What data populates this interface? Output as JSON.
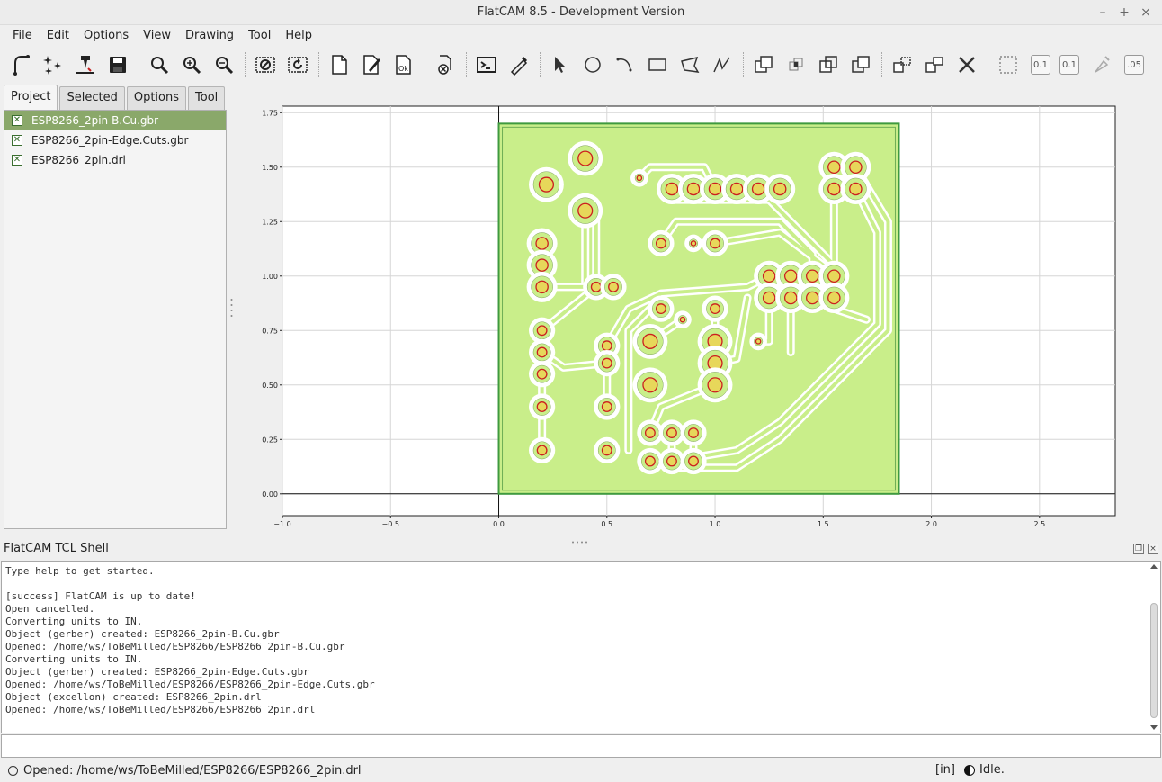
{
  "window": {
    "title": "FlatCAM 8.5 - Development Version",
    "controls": [
      "–",
      "+",
      "×"
    ]
  },
  "menu": [
    "File",
    "Edit",
    "Options",
    "View",
    "Drawing",
    "Tool",
    "Help"
  ],
  "toolbar": {
    "icons": [
      "open-gerber-icon",
      "open-excellon-icon",
      "open-gcode-icon",
      "save-icon",
      "zoom-fit-icon",
      "zoom-in-icon",
      "zoom-out-icon",
      "clear-plot-icon",
      "replot-icon",
      "new-geometry-icon",
      "edit-geometry-icon",
      "update-geometry-icon",
      "delete-object-icon",
      "tcl-shell-icon",
      "measure-icon",
      "select-icon",
      "circle-icon",
      "arc-icon",
      "rectangle-icon",
      "polygon-icon",
      "path-icon",
      "union-icon",
      "intersection-icon",
      "subtraction-icon",
      "cut-icon",
      "copy-shape-icon",
      "move-shape-icon",
      "delete-shape-icon"
    ],
    "snap_grid_x": "0.1",
    "snap_grid_y": "0.1",
    "snap_max": ".05"
  },
  "tabs": [
    {
      "label": "Project",
      "active": true
    },
    {
      "label": "Selected",
      "active": false
    },
    {
      "label": "Options",
      "active": false
    },
    {
      "label": "Tool",
      "active": false
    }
  ],
  "project": {
    "items": [
      {
        "name": "ESP8266_2pin-B.Cu.gbr",
        "selected": true
      },
      {
        "name": "ESP8266_2pin-Edge.Cuts.gbr",
        "selected": false
      },
      {
        "name": "ESP8266_2pin.drl",
        "selected": false
      }
    ]
  },
  "chart_data": {
    "type": "scatter",
    "title": "",
    "xlabel": "",
    "ylabel": "",
    "xlim": [
      -1.0,
      2.85
    ],
    "ylim": [
      -0.1,
      1.78
    ],
    "xticks": [
      -1.0,
      -0.5,
      0.0,
      0.5,
      1.0,
      1.5,
      2.0,
      2.5
    ],
    "yticks": [
      0.0,
      0.25,
      0.5,
      0.75,
      1.0,
      1.25,
      1.5,
      1.75
    ],
    "grid": true,
    "board_outline": {
      "x": [
        0.0,
        1.85
      ],
      "y": [
        0.0,
        1.7
      ]
    },
    "colors": {
      "board_fill": "#c9ee8a",
      "board_edge": "#3f9a3f",
      "pad_fill": "#e7d75a",
      "drill": "#cc1f1f",
      "trace": "#ffffff"
    },
    "pads": [
      [
        0.4,
        1.54,
        0.06
      ],
      [
        0.22,
        1.42,
        0.06
      ],
      [
        0.4,
        1.3,
        0.06
      ],
      [
        0.2,
        1.15,
        0.05
      ],
      [
        0.2,
        1.05,
        0.05
      ],
      [
        0.2,
        0.95,
        0.05
      ],
      [
        0.45,
        0.95,
        0.04
      ],
      [
        0.53,
        0.95,
        0.04
      ],
      [
        0.2,
        0.75,
        0.04
      ],
      [
        0.2,
        0.65,
        0.04
      ],
      [
        0.2,
        0.55,
        0.04
      ],
      [
        0.2,
        0.4,
        0.04
      ],
      [
        0.2,
        0.2,
        0.04
      ],
      [
        0.5,
        0.68,
        0.04
      ],
      [
        0.5,
        0.6,
        0.04
      ],
      [
        0.5,
        0.4,
        0.04
      ],
      [
        0.5,
        0.2,
        0.04
      ],
      [
        0.65,
        1.45,
        0.02
      ],
      [
        0.8,
        1.4,
        0.05
      ],
      [
        0.9,
        1.4,
        0.05
      ],
      [
        1.0,
        1.4,
        0.05
      ],
      [
        1.1,
        1.4,
        0.05
      ],
      [
        1.2,
        1.4,
        0.05
      ],
      [
        1.3,
        1.4,
        0.05
      ],
      [
        0.75,
        1.15,
        0.04
      ],
      [
        0.9,
        1.15,
        0.02
      ],
      [
        1.0,
        1.15,
        0.04
      ],
      [
        1.55,
        1.5,
        0.05
      ],
      [
        1.65,
        1.5,
        0.05
      ],
      [
        1.55,
        1.4,
        0.05
      ],
      [
        1.65,
        1.4,
        0.05
      ],
      [
        1.25,
        1.0,
        0.05
      ],
      [
        1.35,
        1.0,
        0.05
      ],
      [
        1.45,
        1.0,
        0.05
      ],
      [
        1.55,
        1.0,
        0.05
      ],
      [
        1.25,
        0.9,
        0.05
      ],
      [
        1.35,
        0.9,
        0.05
      ],
      [
        1.45,
        0.9,
        0.05
      ],
      [
        1.55,
        0.9,
        0.05
      ],
      [
        0.75,
        0.85,
        0.04
      ],
      [
        0.85,
        0.8,
        0.02
      ],
      [
        1.0,
        0.85,
        0.04
      ],
      [
        0.7,
        0.7,
        0.06
      ],
      [
        1.0,
        0.7,
        0.06
      ],
      [
        1.0,
        0.6,
        0.06
      ],
      [
        1.0,
        0.5,
        0.06
      ],
      [
        0.7,
        0.5,
        0.06
      ],
      [
        1.2,
        0.7,
        0.02
      ],
      [
        0.7,
        0.28,
        0.04
      ],
      [
        0.8,
        0.28,
        0.04
      ],
      [
        0.9,
        0.28,
        0.04
      ],
      [
        0.7,
        0.15,
        0.04
      ],
      [
        0.8,
        0.15,
        0.04
      ],
      [
        0.9,
        0.15,
        0.04
      ]
    ],
    "traces": [
      [
        [
          0.4,
          1.3
        ],
        [
          0.4,
          0.95
        ],
        [
          0.2,
          0.95
        ]
      ],
      [
        [
          0.4,
          1.3
        ],
        [
          0.45,
          1.3
        ],
        [
          0.45,
          0.95
        ]
      ],
      [
        [
          0.2,
          0.75
        ],
        [
          0.45,
          0.95
        ]
      ],
      [
        [
          0.2,
          0.65
        ],
        [
          0.3,
          0.58
        ],
        [
          0.5,
          0.6
        ],
        [
          0.5,
          0.4
        ]
      ],
      [
        [
          0.2,
          0.55
        ],
        [
          0.2,
          0.2
        ]
      ],
      [
        [
          0.5,
          0.68
        ],
        [
          0.6,
          0.85
        ],
        [
          0.75,
          0.92
        ],
        [
          1.15,
          0.95
        ],
        [
          1.25,
          1.0
        ]
      ],
      [
        [
          0.65,
          1.45
        ],
        [
          0.7,
          1.5
        ],
        [
          0.95,
          1.5
        ],
        [
          1.0,
          1.4
        ]
      ],
      [
        [
          0.8,
          1.4
        ],
        [
          0.8,
          1.35
        ],
        [
          1.25,
          1.35
        ],
        [
          1.55,
          1.05
        ],
        [
          1.55,
          1.0
        ]
      ],
      [
        [
          0.75,
          1.15
        ],
        [
          0.82,
          1.25
        ],
        [
          1.3,
          1.25
        ],
        [
          1.45,
          1.1
        ],
        [
          1.45,
          1.0
        ]
      ],
      [
        [
          0.9,
          1.15
        ],
        [
          1.0,
          1.15
        ],
        [
          1.3,
          1.2
        ],
        [
          1.5,
          1.05
        ]
      ],
      [
        [
          1.55,
          1.4
        ],
        [
          1.55,
          0.85
        ],
        [
          1.7,
          0.8
        ]
      ],
      [
        [
          1.65,
          1.4
        ],
        [
          1.75,
          1.2
        ],
        [
          1.75,
          0.78
        ],
        [
          1.3,
          0.33
        ],
        [
          1.1,
          0.2
        ],
        [
          0.8,
          0.15
        ]
      ],
      [
        [
          1.65,
          1.5
        ],
        [
          1.8,
          1.25
        ],
        [
          1.8,
          0.75
        ],
        [
          1.3,
          0.25
        ],
        [
          1.1,
          0.12
        ],
        [
          0.8,
          0.12
        ]
      ],
      [
        [
          0.7,
          0.7
        ],
        [
          0.85,
          0.8
        ]
      ],
      [
        [
          1.0,
          0.85
        ],
        [
          1.0,
          0.7
        ]
      ],
      [
        [
          1.25,
          0.9
        ],
        [
          1.25,
          0.7
        ],
        [
          1.2,
          0.7
        ]
      ],
      [
        [
          1.35,
          0.9
        ],
        [
          1.35,
          0.65
        ]
      ],
      [
        [
          0.8,
          0.28
        ],
        [
          0.8,
          0.15
        ]
      ],
      [
        [
          0.9,
          0.28
        ],
        [
          0.9,
          0.15
        ]
      ],
      [
        [
          0.7,
          0.28
        ],
        [
          0.75,
          0.4
        ],
        [
          1.0,
          0.5
        ]
      ],
      [
        [
          0.6,
          0.2
        ],
        [
          0.6,
          0.75
        ],
        [
          0.7,
          0.85
        ]
      ],
      [
        [
          1.0,
          0.6
        ],
        [
          1.1,
          0.62
        ],
        [
          1.15,
          0.9
        ]
      ]
    ]
  },
  "shell": {
    "title": "FlatCAM TCL Shell",
    "lines": [
      "Type help to get started.",
      "",
      "[success] FlatCAM is up to date!",
      "Open cancelled.",
      "Converting units to IN.",
      "Object (gerber) created: ESP8266_2pin-B.Cu.gbr",
      "Opened: /home/ws/ToBeMilled/ESP8266/ESP8266_2pin-B.Cu.gbr",
      "Converting units to IN.",
      "Object (gerber) created: ESP8266_2pin-Edge.Cuts.gbr",
      "Opened: /home/ws/ToBeMilled/ESP8266/ESP8266_2pin-Edge.Cuts.gbr",
      "Object (excellon) created: ESP8266_2pin.drl",
      "Opened: /home/ws/ToBeMilled/ESP8266/ESP8266_2pin.drl"
    ],
    "input_value": ""
  },
  "status": {
    "message": "Opened: /home/ws/ToBeMilled/ESP8266/ESP8266_2pin.drl",
    "units": "[in]",
    "state": "Idle."
  }
}
